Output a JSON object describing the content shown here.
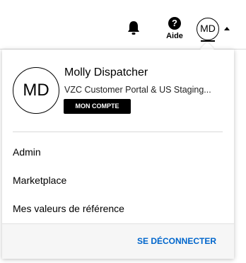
{
  "header": {
    "help_label": "Aide",
    "help_symbol": "?",
    "avatar_initials": "MD"
  },
  "profile_menu": {
    "avatar_initials": "MD",
    "user_name": "Molly Dispatcher",
    "user_context": "VZC Customer Portal & US Staging...",
    "account_button_label": "MON COMPTE",
    "items": [
      {
        "label": "Admin"
      },
      {
        "label": "Marketplace"
      },
      {
        "label": "Mes valeurs de référence"
      }
    ],
    "logout_label": "SE DÉCONNECTER"
  },
  "colors": {
    "accent_link": "#0066cc",
    "button_bg": "#000000",
    "footer_bg": "#f6f6f6"
  },
  "icons": [
    "bell-icon",
    "help-icon",
    "caret-up-icon"
  ]
}
